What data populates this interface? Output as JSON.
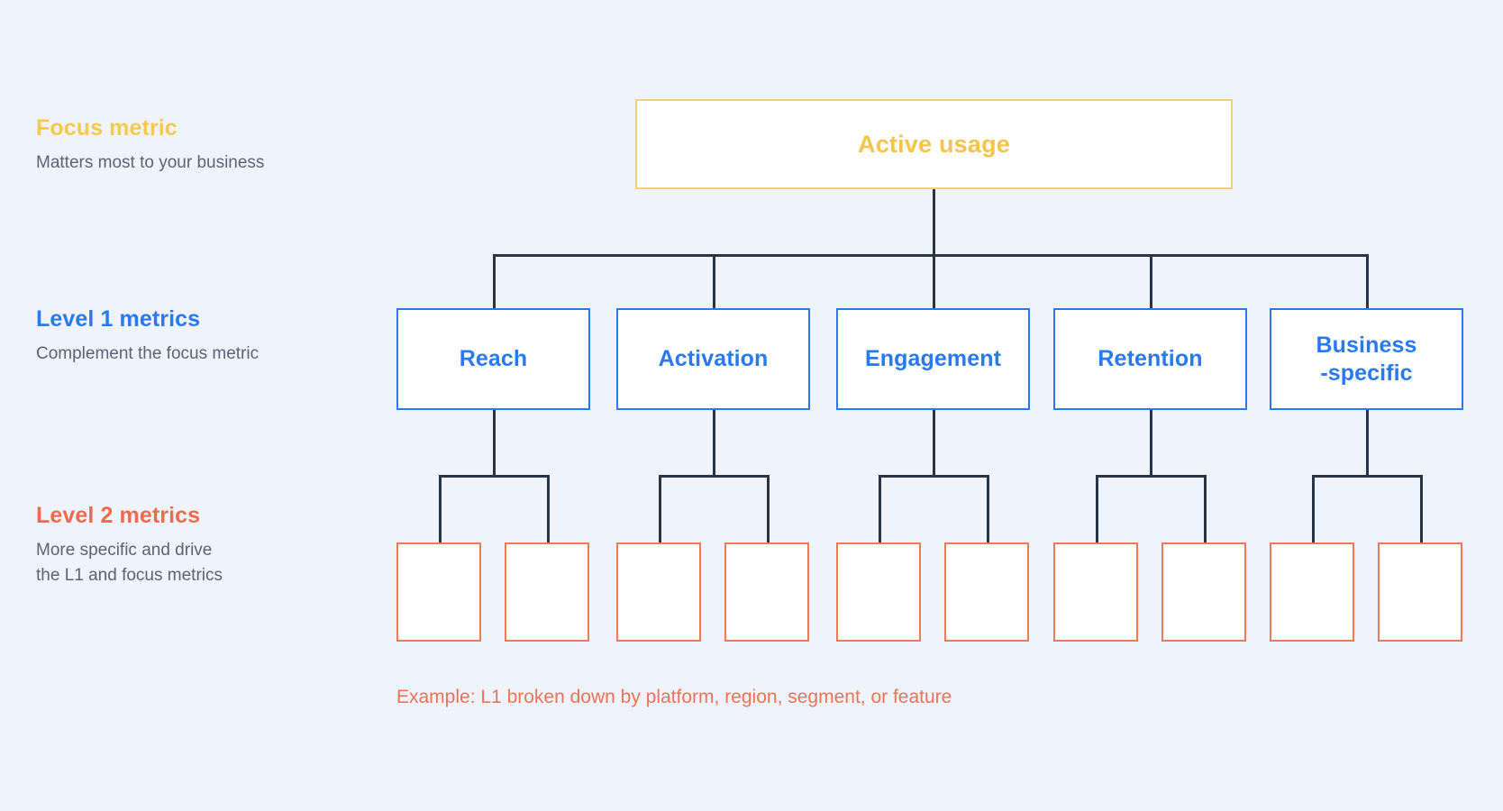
{
  "background_color": "#eef3fc",
  "legend": [
    {
      "id": "focus",
      "title": "Focus metric",
      "description": "Matters most to your business",
      "color": "#f5c84e"
    },
    {
      "id": "level1",
      "title": "Level 1 metrics",
      "description": "Complement the focus metric",
      "color": "#2979f0"
    },
    {
      "id": "level2",
      "title": "Level 2 metrics",
      "description": "More specific and drive\nthe L1 and focus metrics",
      "color": "#ee6c4d"
    }
  ],
  "diagram": {
    "focus_node": {
      "label": "Active usage",
      "border_color": "#f2d07a",
      "text_color": "#f5c44a"
    },
    "level1_nodes": [
      {
        "label": "Reach"
      },
      {
        "label": "Activation"
      },
      {
        "label": "Engagement"
      },
      {
        "label": "Retention"
      },
      {
        "label": "Business\n-specific"
      }
    ],
    "level2_nodes": [
      {
        "label": ""
      },
      {
        "label": ""
      },
      {
        "label": ""
      },
      {
        "label": ""
      },
      {
        "label": ""
      },
      {
        "label": ""
      },
      {
        "label": ""
      },
      {
        "label": ""
      },
      {
        "label": ""
      },
      {
        "label": ""
      }
    ],
    "level1_border_color": "#2979f0",
    "level2_border_color": "#ef7a55",
    "connector_color": "#2b3445"
  },
  "caption": {
    "text": "Example: L1 broken down by platform, region, segment, or feature",
    "color": "#ee7355"
  }
}
